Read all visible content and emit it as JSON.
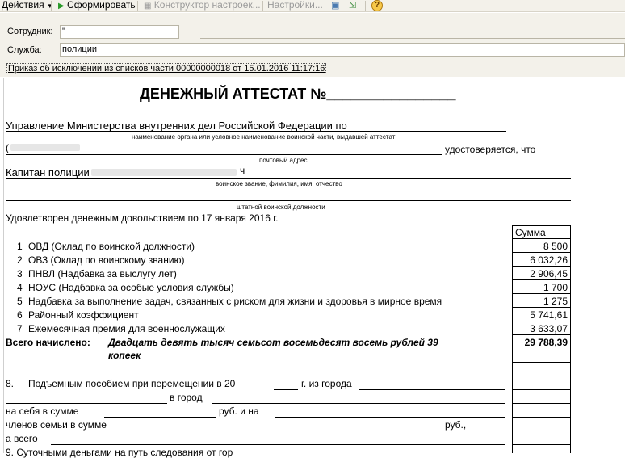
{
  "toolbar": {
    "actions": "Действия",
    "form": "Сформировать",
    "constructor": "Конструктор настроек...",
    "settings": "Настройки..."
  },
  "form": {
    "employee_label": "Сотрудник:",
    "employee_value": "\"",
    "service_label": "Служба:",
    "service_value": "полиции",
    "order_link": "Приказ об исключении из списков части 00000000018 от 15.01.2016 11:17:16"
  },
  "doc": {
    "title": "ДЕНЕЖНЫЙ АТТЕСТАТ №________________",
    "org": "Управление Министерства внутренних дел Российской Федерации по",
    "org_caption": "наименование органа или условное наименование воинской части, выдавшей аттестат",
    "address_prefix": "(",
    "certifies": "удостоверяется, что",
    "address_caption": "почтовый адрес",
    "rank_name": "Капитан полиции",
    "rank_tail": "ч",
    "rank_caption": "воинское звание, фимилия, имя, отчество",
    "position_caption": "штатной воинской должности",
    "satisfied": "Удовлетворен денежным довольствием по 17 января 2016 г.",
    "sum_header": "Сумма",
    "rows": [
      {
        "n": "1",
        "label": "ОВД (Оклад по воинской должности)",
        "amount": "8 500"
      },
      {
        "n": "2",
        "label": "ОВЗ (Оклад по воинскому званию)",
        "amount": "6 032,26"
      },
      {
        "n": "3",
        "label": "ПНВЛ (Надбавка за выслугу лет)",
        "amount": "2 906,45"
      },
      {
        "n": "4",
        "label": "НОУС (Надбавка за особые условия службы)",
        "amount": "1 700"
      },
      {
        "n": "5",
        "label": "Надбавка за выполнение задач, связанных с риском для жизни и здоровья в мирное время",
        "amount": "1 275"
      },
      {
        "n": "6",
        "label": "Районный коэффициент",
        "amount": "5 741,61"
      },
      {
        "n": "7",
        "label": "Ежемесячная премия для военнослужащих",
        "amount": "3 633,07"
      }
    ],
    "total_label": "Всего начислено:",
    "total_words_1": "Двадцать девять тысяч семьсот восемьдесят восемь рублей 39",
    "total_words_2": "копеек",
    "total_amount": "29 788,39",
    "p8_num": "8.",
    "p8_text": "Подъемным пособием при перемещении  в  20",
    "p8_from": "г. из города",
    "p8_to": "в город",
    "self_sum": "на себя в сумме",
    "rub_and": "руб. и на",
    "family_sum": "членов семьи в сумме",
    "rub": "руб.,",
    "total_all": "а всего",
    "p9_text": "9.     Суточными деньгами на путь следования от гор"
  }
}
